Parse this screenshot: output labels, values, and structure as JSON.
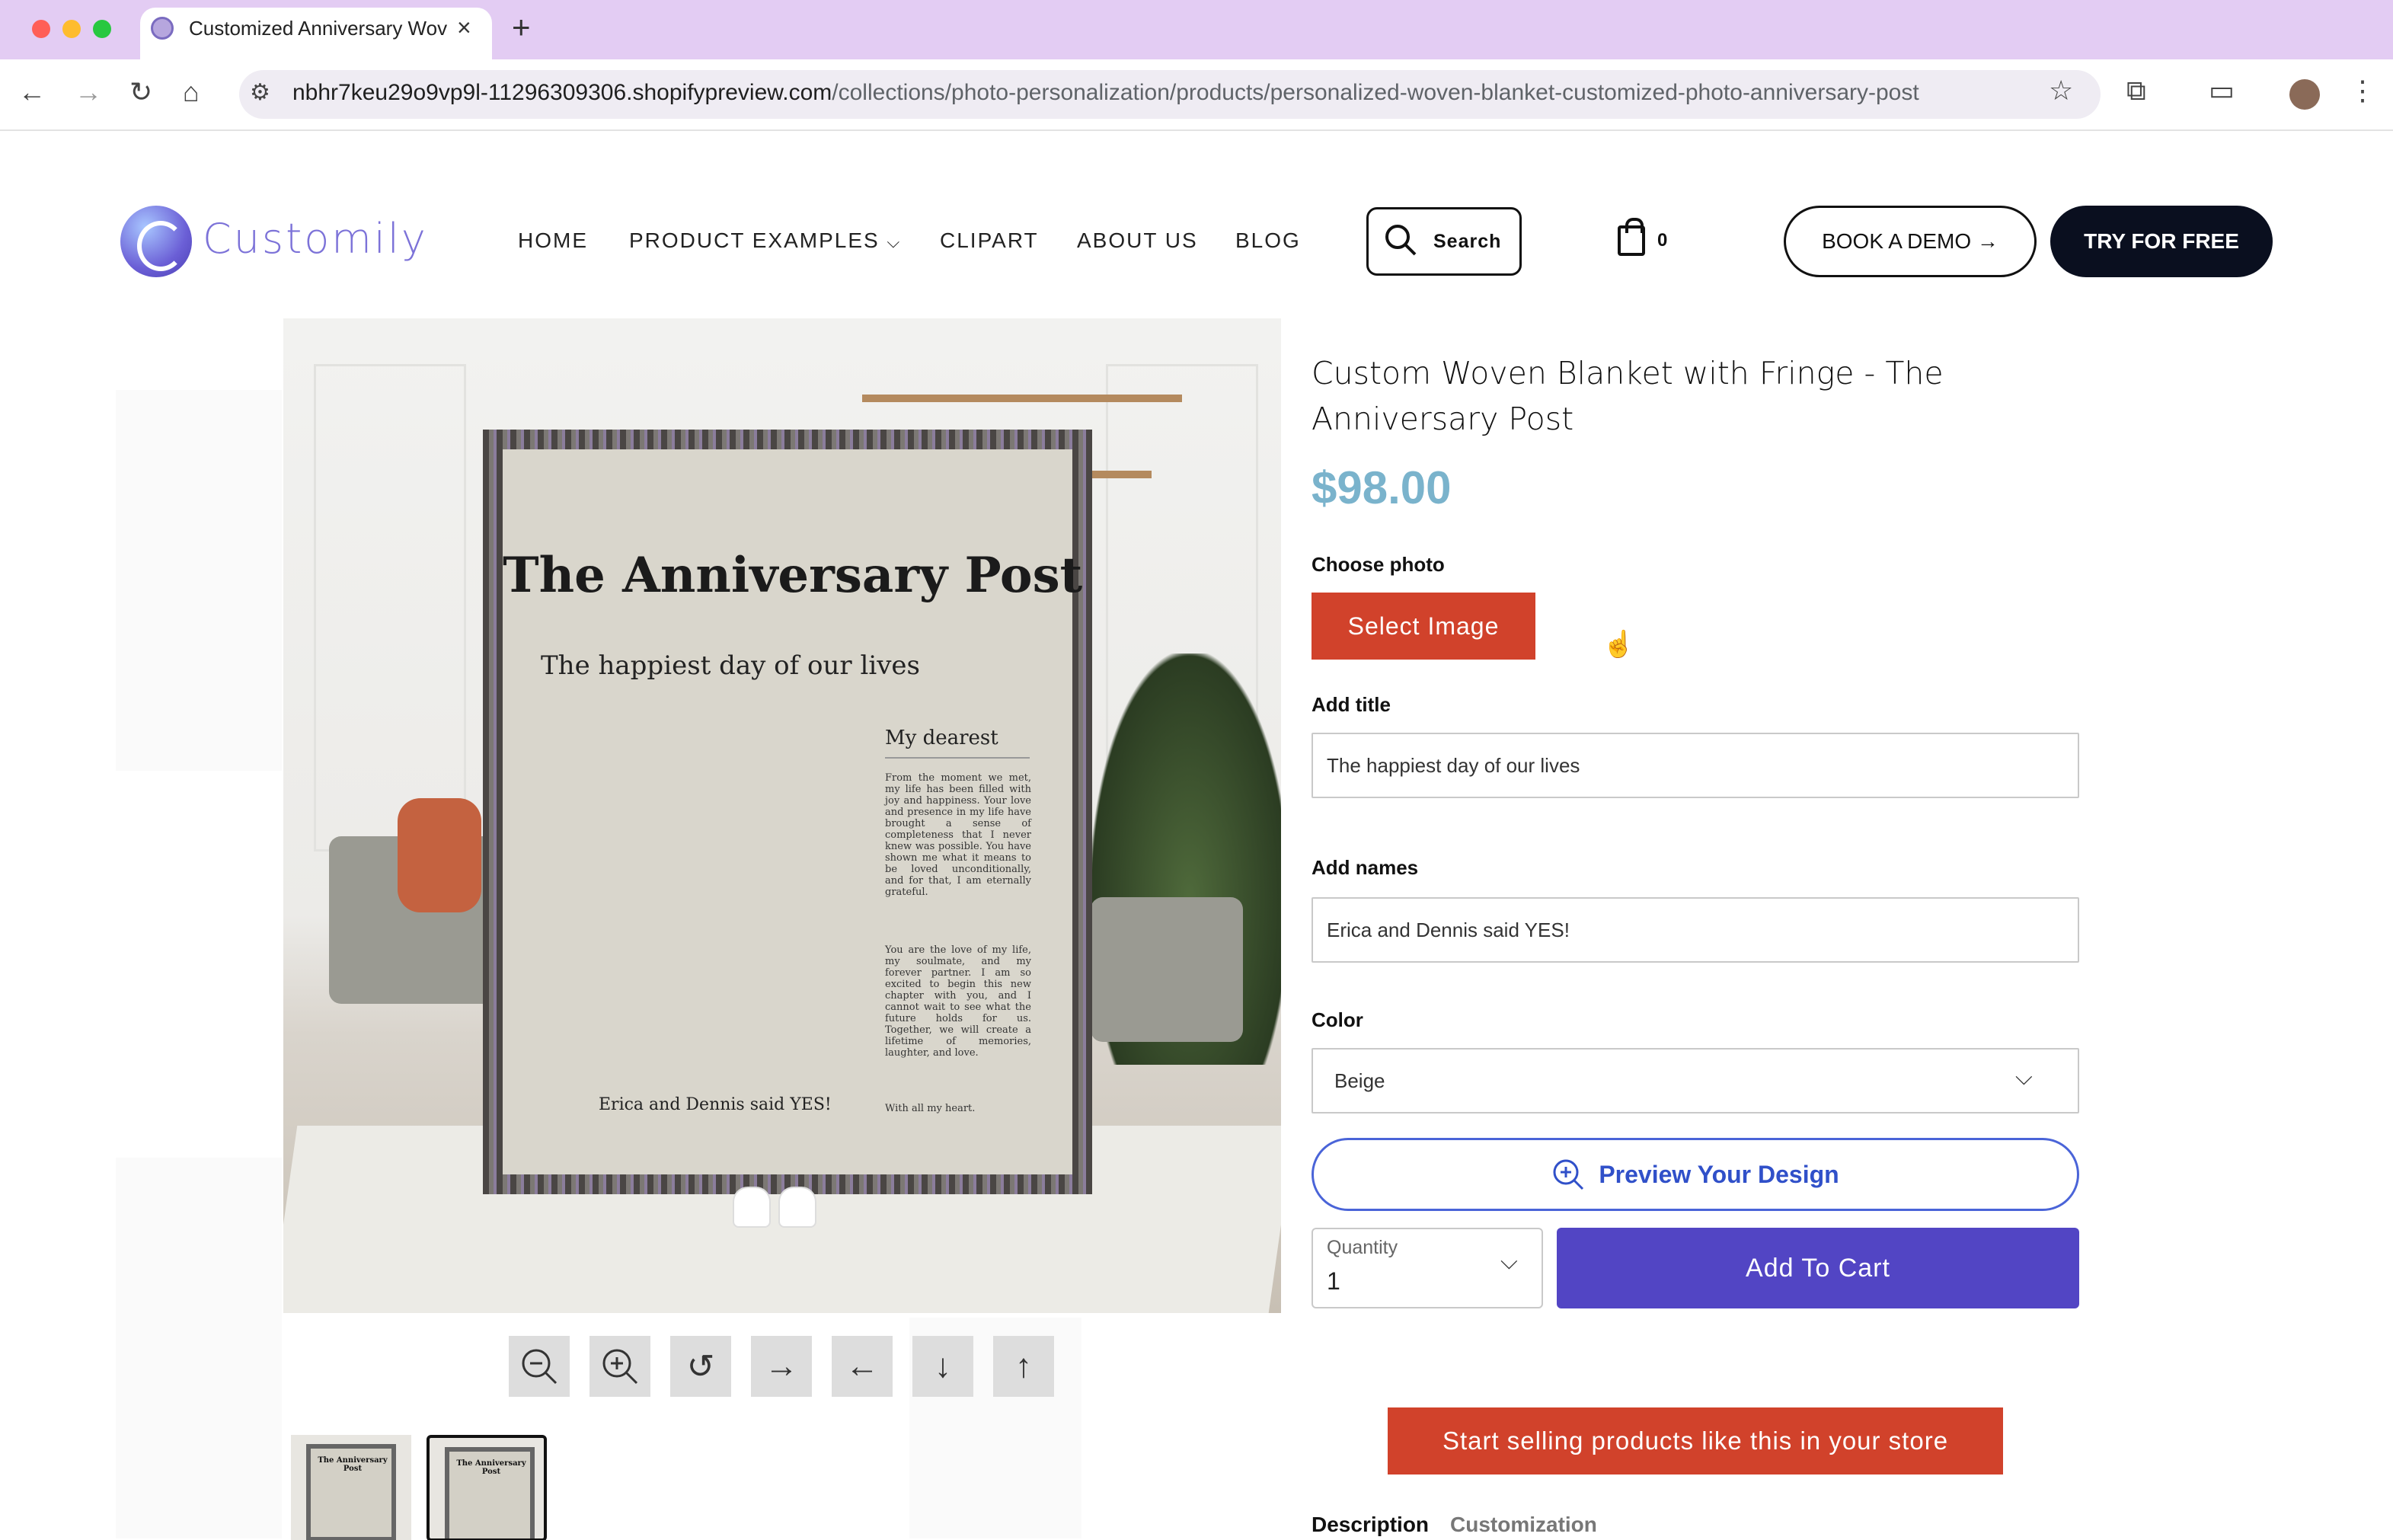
{
  "browser": {
    "tab_title": "Customized Anniversary Wov",
    "url_host": "nbhr7keu29o9vp9l-11296309306.shopifypreview.com",
    "url_path": "/collections/photo-personalization/products/personalized-woven-blanket-customized-photo-anniversary-post"
  },
  "header": {
    "logo": "Customily",
    "nav": [
      "HOME",
      "PRODUCT EXAMPLES",
      "CLIPART",
      "ABOUT US",
      "BLOG"
    ],
    "search_label": "Search",
    "cart_count": "0",
    "demo_button": "BOOK A DEMO →",
    "try_button": "TRY FOR FREE"
  },
  "blanket": {
    "title": "The Anniversary Post",
    "subtitle": "The happiest day of our lives",
    "letter_heading": "My dearest",
    "letter_body_1": "From the moment we met, my life has been filled with joy and happiness. Your love and presence in my life have brought a sense of completeness that I never knew was possible. You have shown me what it means to be loved unconditionally, and for that, I am eternally grateful.",
    "letter_body_2": "You are the love of my life, my soulmate, and my forever partner. I am so excited to begin this new chapter with you, and I cannot wait to see what the future holds for us. Together, we will create a lifetime of memories, laughter, and love.",
    "letter_signoff": "With all my heart.",
    "names": "Erica and Dennis said YES!"
  },
  "product": {
    "title": "Custom Woven Blanket with Fringe - The Anniversary Post",
    "price": "$98.00",
    "choose_photo_label": "Choose photo",
    "select_image_button": "Select Image",
    "add_title_label": "Add title",
    "add_title_value": "The happiest day of our lives",
    "add_names_label": "Add names",
    "add_names_value": "Erica and Dennis said YES!",
    "color_label": "Color",
    "color_value": "Beige",
    "preview_button": "Preview Your Design",
    "quantity_label": "Quantity",
    "quantity_value": "1",
    "add_to_cart_button": "Add To Cart",
    "sell_button": "Start selling products like this in your store",
    "tabs": [
      "Description",
      "Customization"
    ]
  },
  "colors": {
    "accent_red": "#d1422b",
    "cart_purple": "#5245c4",
    "price_blue": "#7ab3cc",
    "preview_blue": "#3050c9"
  }
}
